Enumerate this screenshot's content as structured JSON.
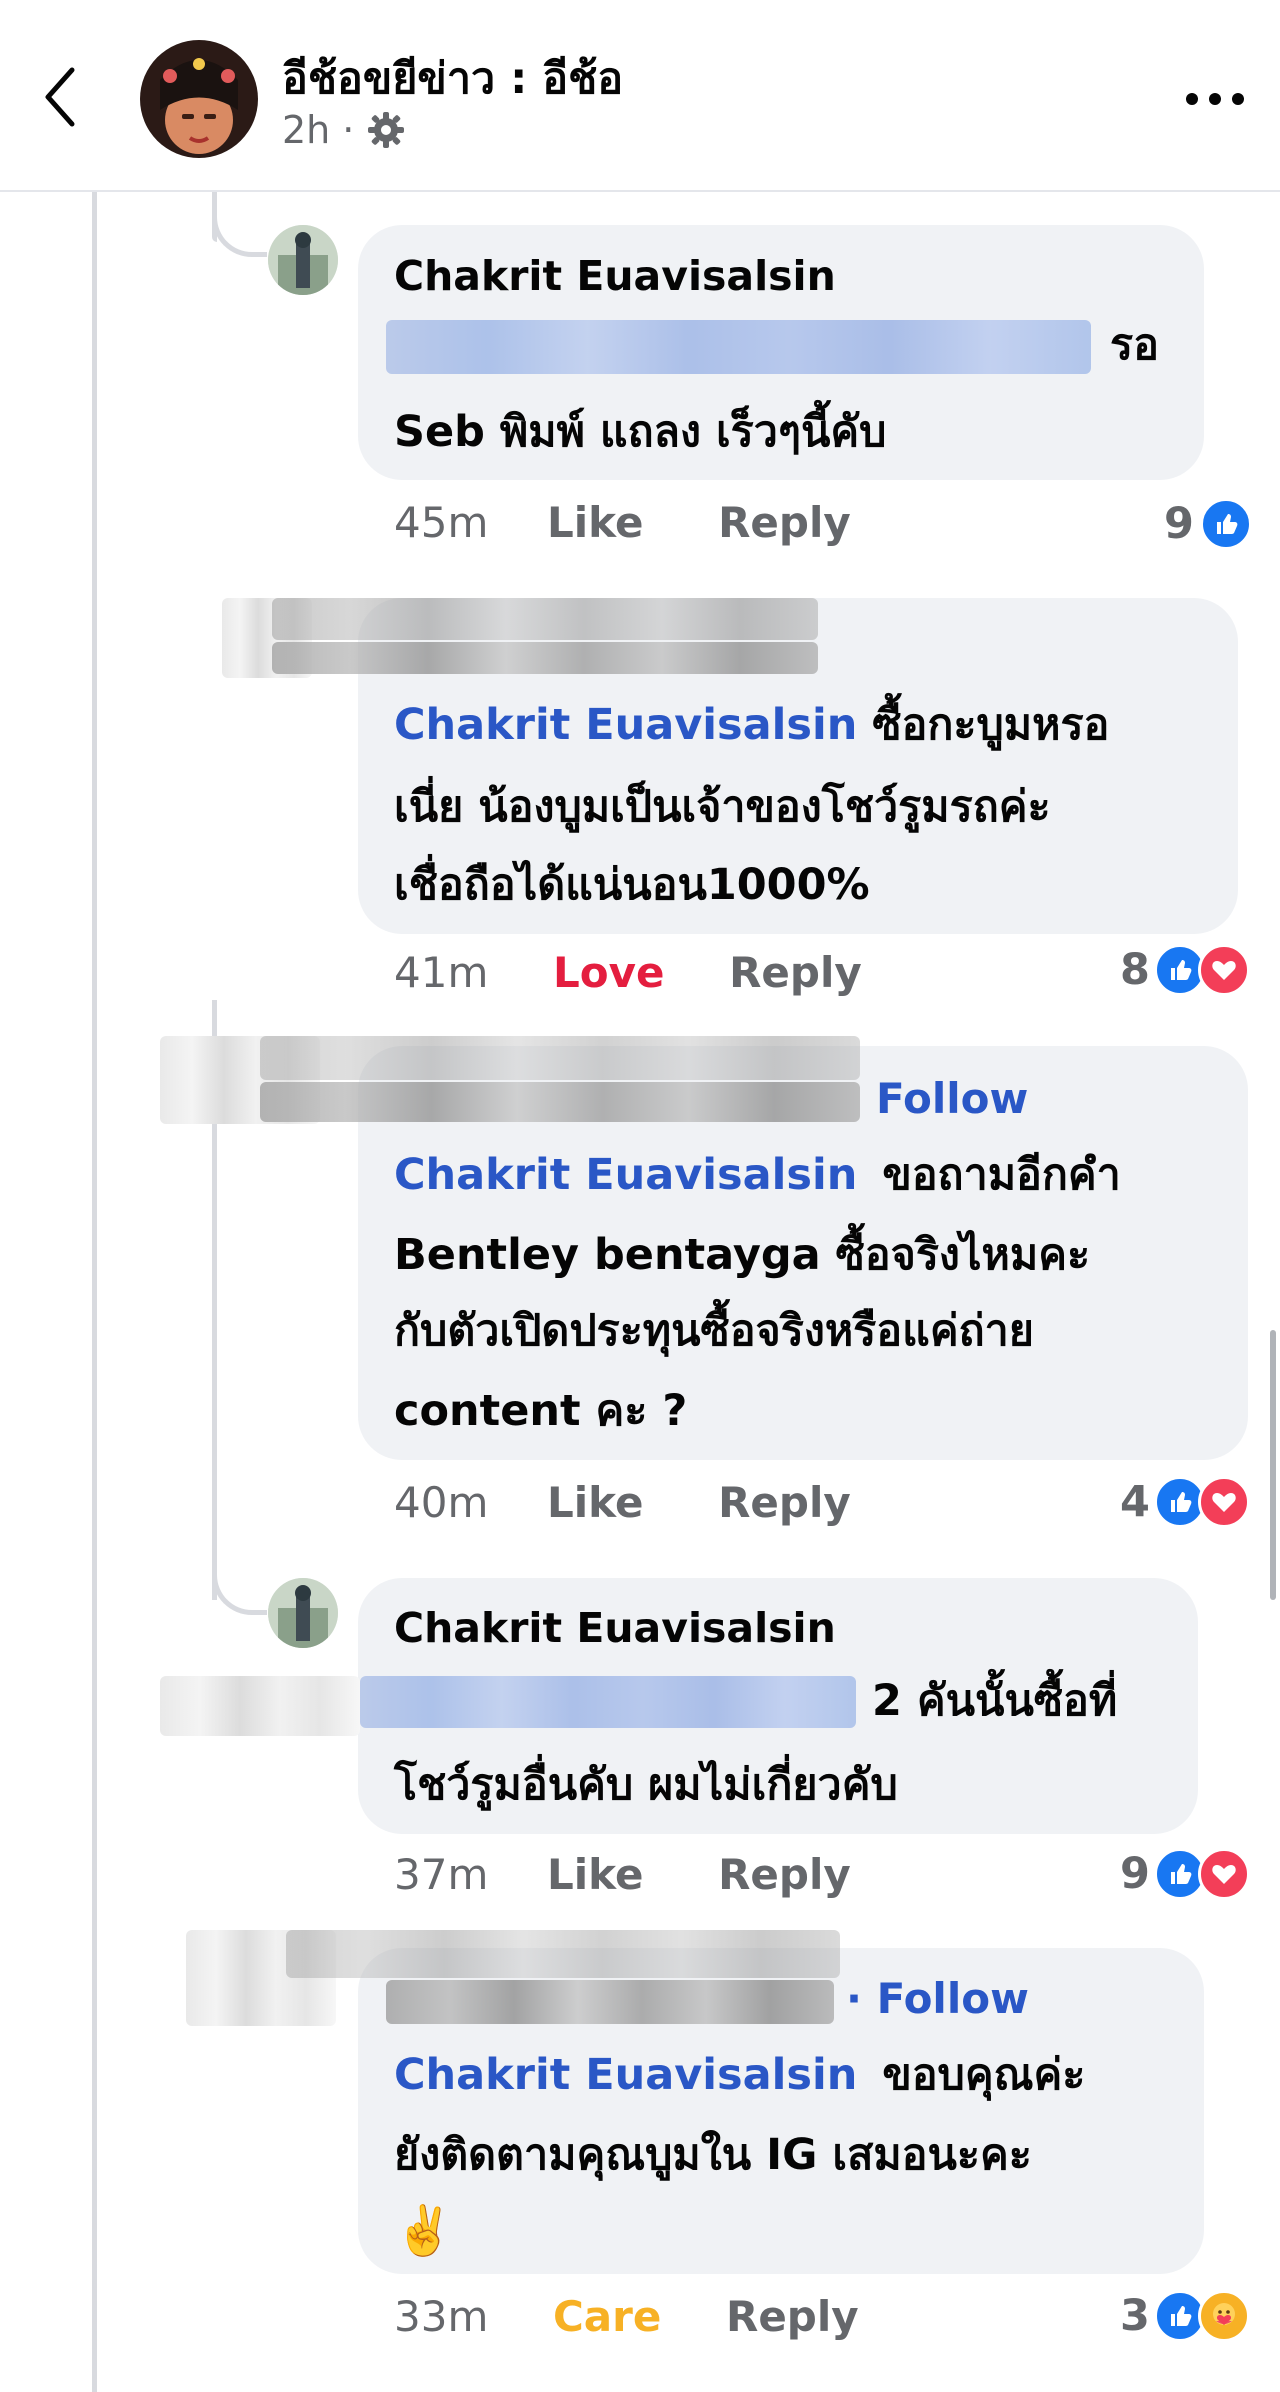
{
  "header": {
    "page_name": "อีช้อขยีข่าว : อีช้อ",
    "post_time": "2h",
    "audience_icon": "gear-icon",
    "back_icon": "chevron-left-icon",
    "more_icon": "more-horizontal-icon"
  },
  "comments": [
    {
      "author": "Chakrit Euavisalsin",
      "line1_suffix": "รอ",
      "line2": "Seb พิมพ์ แถลง เร็วๆนี้คับ",
      "time": "45m",
      "action": "Like",
      "reply": "Reply",
      "reaction_count": "9",
      "reactions": [
        "like-icon"
      ]
    },
    {
      "mention": "Chakrit Euavisalsin",
      "line1_rest": "ซื้อกะบูมหรอ",
      "line2": "เนี่ย น้องบูมเป็นเจ้าของโชว์รูมรถค่ะ",
      "line3": "เชื่อถือได้แน่นอน1000%",
      "time": "41m",
      "action": "Love",
      "reply": "Reply",
      "reaction_count": "8",
      "reactions": [
        "like-icon",
        "love-icon"
      ]
    },
    {
      "follow": "Follow",
      "mention": "Chakrit Euavisalsin",
      "line1_rest": "ขอถามอีกคำ",
      "line2": "Bentley bentayga ซื้อจริงไหมคะ",
      "line3": "กับตัวเปิดประทุนซื้อจริงหรือแค่ถ่าย",
      "line4": "content คะ ?",
      "time": "40m",
      "action": "Like",
      "reply": "Reply",
      "reaction_count": "4",
      "reactions": [
        "like-icon",
        "love-icon"
      ]
    },
    {
      "author": "Chakrit Euavisalsin",
      "line1_suffix": "2 คันนั้นซื้อที่",
      "line2": "โชว์รูมอื่นคับ ผมไม่เกี่ยวคับ",
      "time": "37m",
      "action": "Like",
      "reply": "Reply",
      "reaction_count": "9",
      "reactions": [
        "like-icon",
        "love-icon"
      ]
    },
    {
      "follow": "· Follow",
      "mention": "Chakrit Euavisalsin",
      "line1_rest": "ขอบคุณค่ะ",
      "line2": "ยังติดตามคุณบูมใน IG เสมอนะคะ",
      "line3": "✌️",
      "time": "33m",
      "action": "Care",
      "reply": "Reply",
      "reaction_count": "3",
      "reactions": [
        "like-icon",
        "care-icon"
      ]
    }
  ],
  "colors": {
    "love": "#e41e3f",
    "care": "#f7b125",
    "mention": "#2a57c6",
    "bubble": "#f0f2f5"
  }
}
